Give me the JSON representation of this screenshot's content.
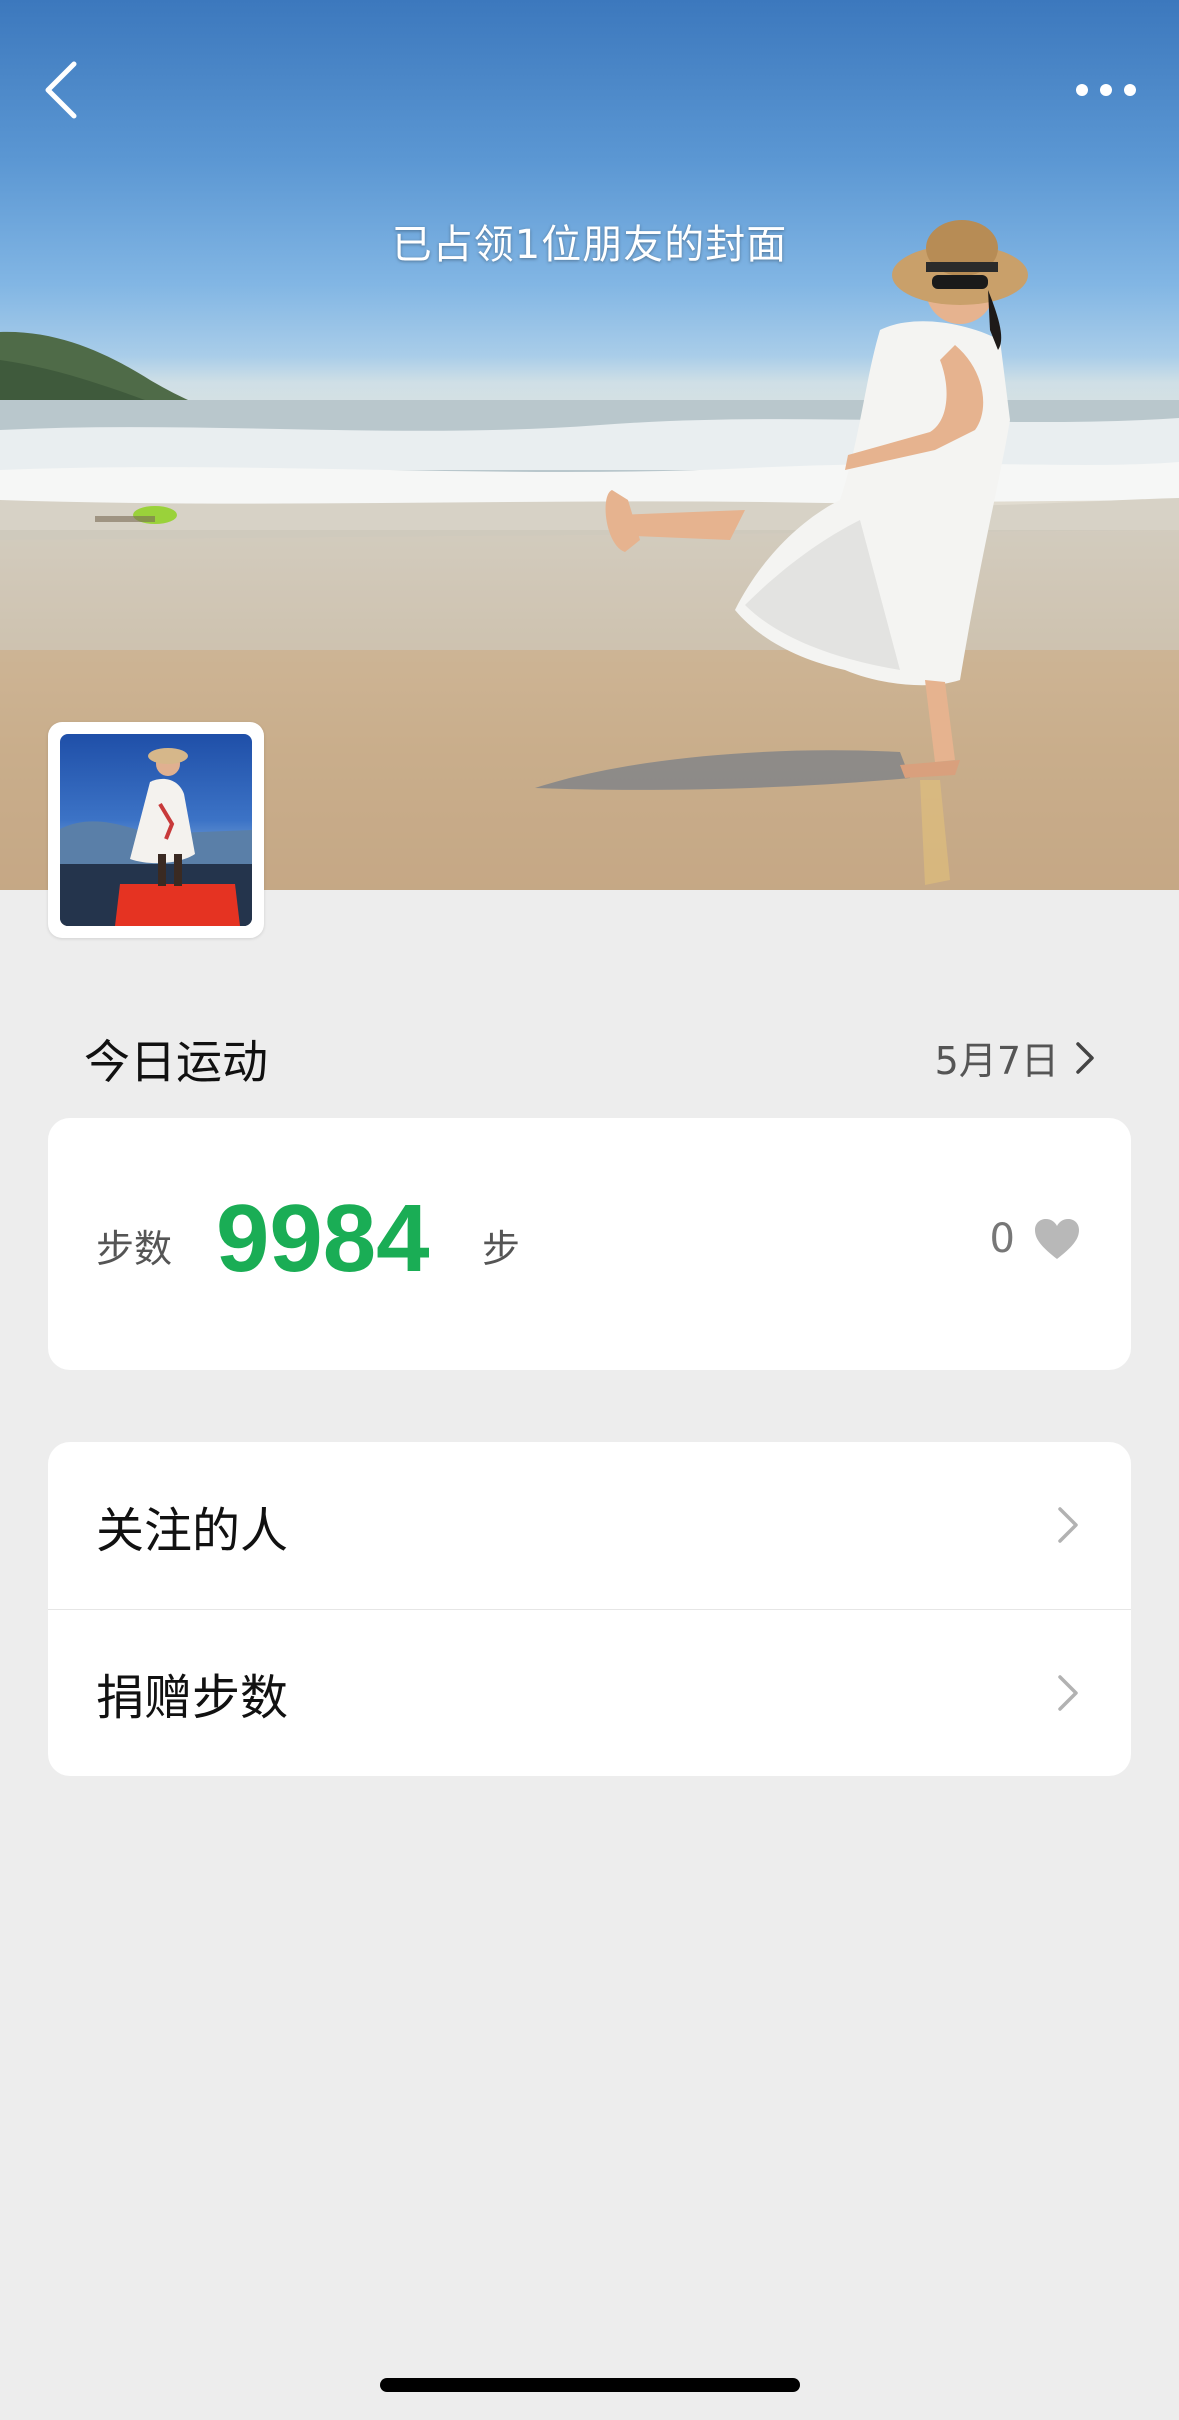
{
  "cover": {
    "caption": "已占领1位朋友的封面"
  },
  "today": {
    "title": "今日运动",
    "date": "5月7日"
  },
  "steps": {
    "label": "步数",
    "value": "9984",
    "unit": "步",
    "likes": "0"
  },
  "menu": {
    "items": [
      {
        "label": "关注的人"
      },
      {
        "label": "捐赠步数"
      }
    ]
  },
  "colors": {
    "accent_green": "#1aad55",
    "background": "#ededed",
    "card": "#ffffff"
  },
  "icons": {
    "back": "back-chevron-icon",
    "more": "more-dots-icon",
    "chevron": "chevron-right-icon",
    "heart": "heart-icon"
  }
}
